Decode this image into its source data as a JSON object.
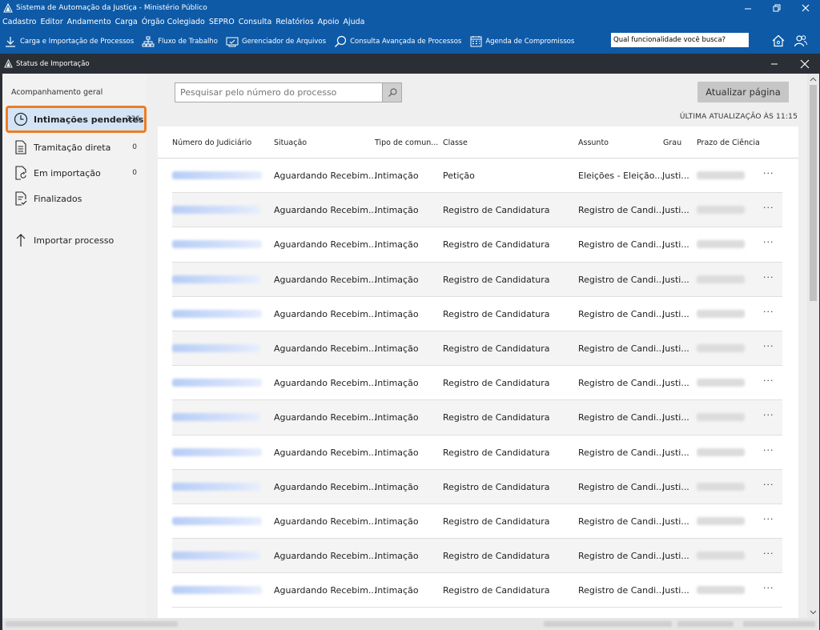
{
  "window": {
    "title": "Sistema de Automação da Justiça - Ministério Público"
  },
  "menu": [
    "Cadastro",
    "Editor",
    "Andamento",
    "Carga",
    "Órgão Colegiado",
    "SEPRO",
    "Consulta",
    "Relatórios",
    "Apoio",
    "Ajuda"
  ],
  "toolbar": {
    "carga_label": "Carga e Importação de Processos",
    "fluxo_label": "Fluxo de Trabalho",
    "gerenciador_label": "Gerenciador de Arquivos",
    "consulta_label": "Consulta Avançada de Processos",
    "agenda_label": "Agenda de Compromissos",
    "search_value": "Qual funcionalidade você busca?"
  },
  "subwindow": {
    "title": "Status de Importação"
  },
  "sidebar": {
    "section_label": "Acompanhamento geral",
    "items": [
      {
        "label": "Intimações pendentes",
        "count": "236"
      },
      {
        "label": "Tramitação direta",
        "count": "0"
      },
      {
        "label": "Em importação",
        "count": "0"
      },
      {
        "label": "Finalizados",
        "count": ""
      },
      {
        "label": "Importar processo",
        "count": ""
      }
    ]
  },
  "main": {
    "search_placeholder": "Pesquisar pelo número do processo",
    "refresh_label": "Atualizar página",
    "last_update": "ÚLTIMA ATUALIZAÇÃO ÀS 11:15"
  },
  "table": {
    "headers": [
      "Número do Judiciário",
      "Situação",
      "Tipo de comun...",
      "Classe",
      "Assunto",
      "Grau",
      "Prazo de Ciência"
    ],
    "rows": [
      {
        "situacao": "Aguardando Recebim...",
        "tipo": "Intimação",
        "classe": "Petição",
        "assunto": "Eleições - Eleição...",
        "grau": "Justi...",
        "more": "···"
      },
      {
        "situacao": "Aguardando Recebim...",
        "tipo": "Intimação",
        "classe": "Registro de Candidatura",
        "assunto": "Registro de Candi...",
        "grau": "Justi...",
        "more": "···"
      },
      {
        "situacao": "Aguardando Recebim...",
        "tipo": "Intimação",
        "classe": "Registro de Candidatura",
        "assunto": "Registro de Candi...",
        "grau": "Justi...",
        "more": "···"
      },
      {
        "situacao": "Aguardando Recebim...",
        "tipo": "Intimação",
        "classe": "Registro de Candidatura",
        "assunto": "Registro de Candi...",
        "grau": "Justi...",
        "more": "···"
      },
      {
        "situacao": "Aguardando Recebim...",
        "tipo": "Intimação",
        "classe": "Registro de Candidatura",
        "assunto": "Registro de Candi...",
        "grau": "Justi...",
        "more": "···"
      },
      {
        "situacao": "Aguardando Recebim...",
        "tipo": "Intimação",
        "classe": "Registro de Candidatura",
        "assunto": "Registro de Candi...",
        "grau": "Justi...",
        "more": "···"
      },
      {
        "situacao": "Aguardando Recebim...",
        "tipo": "Intimação",
        "classe": "Registro de Candidatura",
        "assunto": "Registro de Candi...",
        "grau": "Justi...",
        "more": "···"
      },
      {
        "situacao": "Aguardando Recebim...",
        "tipo": "Intimação",
        "classe": "Registro de Candidatura",
        "assunto": "Registro de Candi...",
        "grau": "Justi...",
        "more": "···"
      },
      {
        "situacao": "Aguardando Recebim...",
        "tipo": "Intimação",
        "classe": "Registro de Candidatura",
        "assunto": "Registro de Candi...",
        "grau": "Justi...",
        "more": "···"
      },
      {
        "situacao": "Aguardando Recebim...",
        "tipo": "Intimação",
        "classe": "Registro de Candidatura",
        "assunto": "Registro de Candi...",
        "grau": "Justi...",
        "more": "···"
      },
      {
        "situacao": "Aguardando Recebim...",
        "tipo": "Intimação",
        "classe": "Registro de Candidatura",
        "assunto": "Registro de Candi...",
        "grau": "Justi...",
        "more": "···"
      },
      {
        "situacao": "Aguardando Recebim...",
        "tipo": "Intimação",
        "classe": "Registro de Candidatura",
        "assunto": "Registro de Candi...",
        "grau": "Justi...",
        "more": "···"
      },
      {
        "situacao": "Aguardando Recebim...",
        "tipo": "Intimação",
        "classe": "Registro de Candidatura",
        "assunto": "Registro de Candi...",
        "grau": "Justi...",
        "more": "···"
      }
    ]
  },
  "colors": {
    "titlebar": "#0e5aa7",
    "subwindow_bar": "#2a2f35",
    "active_border": "#ef7d22",
    "active_bg": "#d4e4f7"
  },
  "icons": [
    "app-logo-icon",
    "minimize-icon",
    "restore-icon",
    "close-icon",
    "download-icon",
    "workflow-icon",
    "file-manager-icon",
    "search-advanced-icon",
    "calendar-icon",
    "home-icon",
    "users-icon",
    "clock-icon",
    "document-icon",
    "document-import-icon",
    "document-done-icon",
    "upload-icon",
    "search-icon"
  ]
}
